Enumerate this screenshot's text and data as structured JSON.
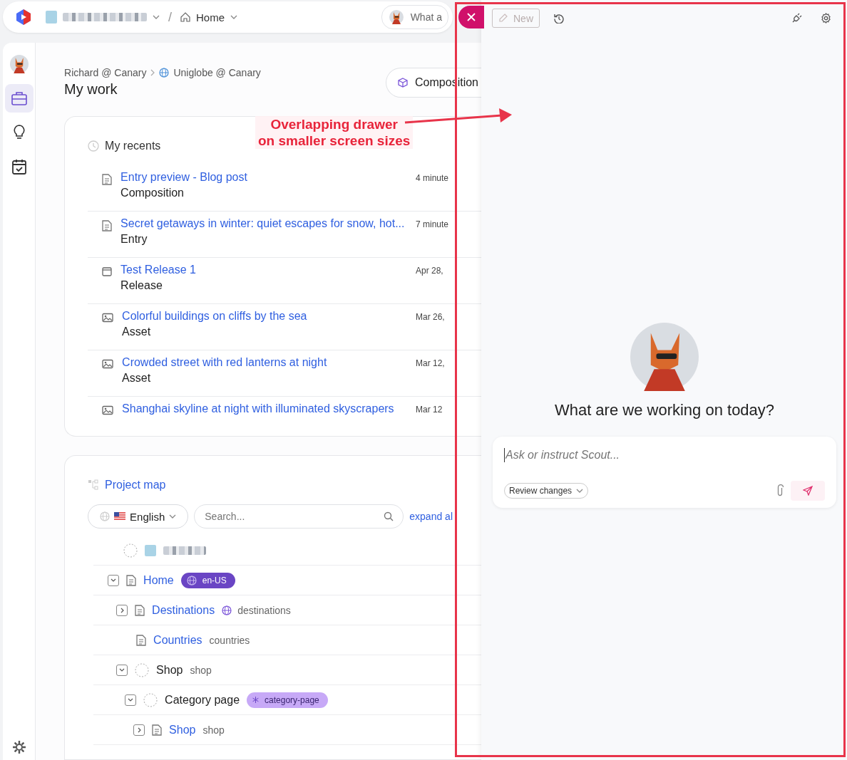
{
  "top_bar": {
    "separator": "/",
    "page": "Home",
    "assistant_field": {
      "placeholder": "What a"
    }
  },
  "sidebar": {
    "items": [
      {
        "kind": "avatar",
        "selected": false
      },
      {
        "kind": "briefcase",
        "selected": true
      },
      {
        "kind": "bulb",
        "selected": false
      },
      {
        "kind": "calendar",
        "selected": false
      }
    ]
  },
  "header": {
    "breadcrumb": [
      "Richard @ Canary",
      "Uniglobe @ Canary"
    ],
    "title": "My work",
    "button": "Composition"
  },
  "recents": {
    "title": "My recents",
    "items": [
      {
        "kind": "document",
        "title": "Entry preview - Blog post",
        "type": "Composition",
        "time": "4 minute"
      },
      {
        "kind": "document",
        "title": "Secret getaways in winter: quiet escapes for snow, hot...",
        "type": "Entry",
        "time": "7 minute"
      },
      {
        "kind": "release",
        "title": "Test Release 1",
        "type": "Release",
        "time": "Apr 28,"
      },
      {
        "kind": "image",
        "title": "Colorful buildings on cliffs by the sea",
        "type": "Asset",
        "time": "Mar 26,"
      },
      {
        "kind": "image",
        "title": "Crowded street with red lanterns at night",
        "type": "Asset",
        "time": "Mar 12,"
      },
      {
        "kind": "image",
        "title": "Shanghai skyline at night with illuminated skyscrapers",
        "time": "Mar 12"
      }
    ]
  },
  "project_map": {
    "title": "Project map",
    "language": "English",
    "search": {
      "placeholder": "Search..."
    },
    "expand_link": "expand al",
    "rows": [
      {
        "kind": "site"
      },
      {
        "kind": "page",
        "label": "Home",
        "expanded": true,
        "badge": {
          "kind": "locale",
          "text": "en-US"
        },
        "children": [
          {
            "kind": "page",
            "label": "Destinations",
            "expanded": false,
            "slug": {
              "kind": "locale",
              "text": "destinations"
            }
          },
          {
            "kind": "page",
            "label": "Countries",
            "slug": {
              "kind": "plain",
              "text": "countries"
            }
          },
          {
            "kind": "folder",
            "label": "Shop",
            "expanded": true,
            "slug": {
              "kind": "plain",
              "text": "shop"
            },
            "children": [
              {
                "kind": "folder",
                "label": "Category page",
                "expanded": true,
                "badge": {
                  "kind": "template",
                  "text": "category-page"
                },
                "children": [
                  {
                    "kind": "page",
                    "label": "Shop",
                    "expanded": false,
                    "slug": {
                      "kind": "plain",
                      "text": "shop"
                    }
                  }
                ]
              }
            ]
          }
        ]
      }
    ]
  },
  "drawer": {
    "new_button": {
      "label": "New",
      "disabled": true
    },
    "heading": "What are we working on today?",
    "input": {
      "placeholder": "Ask or instruct Scout..."
    },
    "mode": "Review changes"
  },
  "annotation": {
    "text": "Overlapping drawer\non smaller screen sizes"
  }
}
